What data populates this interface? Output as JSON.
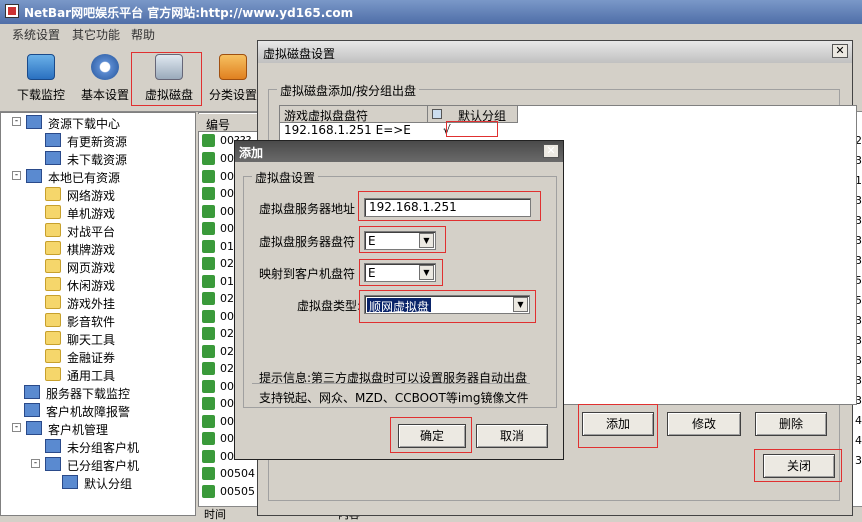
{
  "window": {
    "title": "NetBar网吧娱乐平台 官方网站:http://www.yd165.com"
  },
  "menu": [
    "系统设置",
    "其它功能",
    "帮助"
  ],
  "toolbar": [
    {
      "label": "下载监控",
      "icon": "monitor-icon"
    },
    {
      "label": "基本设置",
      "icon": "gear-icon"
    },
    {
      "label": "虚拟磁盘",
      "icon": "disk-icon"
    },
    {
      "label": "分类设置",
      "icon": "category-icon"
    }
  ],
  "tree": {
    "nodes": [
      {
        "label": "资源下载中心",
        "level": 0,
        "exp": "-"
      },
      {
        "label": "有更新资源",
        "level": 1
      },
      {
        "label": "未下载资源",
        "level": 1
      },
      {
        "label": "本地已有资源",
        "level": 0,
        "exp": "-"
      },
      {
        "label": "网络游戏",
        "level": 1,
        "folder": true
      },
      {
        "label": "单机游戏",
        "level": 1,
        "folder": true
      },
      {
        "label": "对战平台",
        "level": 1,
        "folder": true
      },
      {
        "label": "棋牌游戏",
        "level": 1,
        "folder": true
      },
      {
        "label": "网页游戏",
        "level": 1,
        "folder": true
      },
      {
        "label": "休闲游戏",
        "level": 1,
        "folder": true
      },
      {
        "label": "游戏外挂",
        "level": 1,
        "folder": true
      },
      {
        "label": "影音软件",
        "level": 1,
        "folder": true
      },
      {
        "label": "聊天工具",
        "level": 1,
        "folder": true
      },
      {
        "label": "金融证券",
        "level": 1,
        "folder": true
      },
      {
        "label": "通用工具",
        "level": 1,
        "folder": true
      },
      {
        "label": "服务器下载监控",
        "level": 0
      },
      {
        "label": "客户机故障报警",
        "level": 0
      },
      {
        "label": "客户机管理",
        "level": 0,
        "exp": "-"
      },
      {
        "label": "未分组客户机",
        "level": 1
      },
      {
        "label": "已分组客户机",
        "level": 1,
        "exp": "-"
      },
      {
        "label": "默认分组",
        "level": 2
      }
    ]
  },
  "list": {
    "header": "编号",
    "rows": [
      "00",
      "00",
      "00",
      "00",
      "00",
      "01",
      "02",
      "01",
      "02",
      "00",
      "02",
      "02",
      "02",
      "00",
      "00",
      "00",
      "00",
      "00",
      "00504",
      "00505"
    ],
    "first_row": "00???"
  },
  "bottom_header": {
    "col1": "时间",
    "col2": "内容"
  },
  "right_edge_numbers": [
    "2",
    "3",
    "1",
    "3",
    "3",
    "3",
    "3",
    "5",
    "5",
    "3",
    "3",
    "3",
    "3",
    "3",
    "4",
    "4",
    "3"
  ],
  "vdisk_dialog": {
    "title": "虚拟磁盘设置",
    "group_label": "虚拟磁盘添加/按分组出盘",
    "columns": [
      "游戏虚拟盘盘符",
      "默认分组"
    ],
    "rows": [
      {
        "drive": "192.168.1.251 E=>E",
        "default_group": "√"
      }
    ],
    "buttons": {
      "add": "添加",
      "edit": "修改",
      "delete": "删除",
      "close": "关闭"
    }
  },
  "add_dialog": {
    "title": "添加",
    "group_label": "虚拟盘设置",
    "server_addr_label": "虚拟盘服务器地址",
    "server_addr_value": "192.168.1.251",
    "server_drive_label": "虚拟盘服务器盘符",
    "server_drive_value": "E",
    "client_drive_label": "映射到客户机盘符",
    "client_drive_value": "E",
    "type_label": "虚拟盘类型:",
    "type_value": "顺网虚拟盘",
    "hint1": "提示信息:第三方虚拟盘时可以设置服务器自动出盘",
    "hint2": "支持锐起、网众、MZD、CCBOOT等img镜像文件",
    "ok": "确定",
    "cancel": "取消"
  }
}
